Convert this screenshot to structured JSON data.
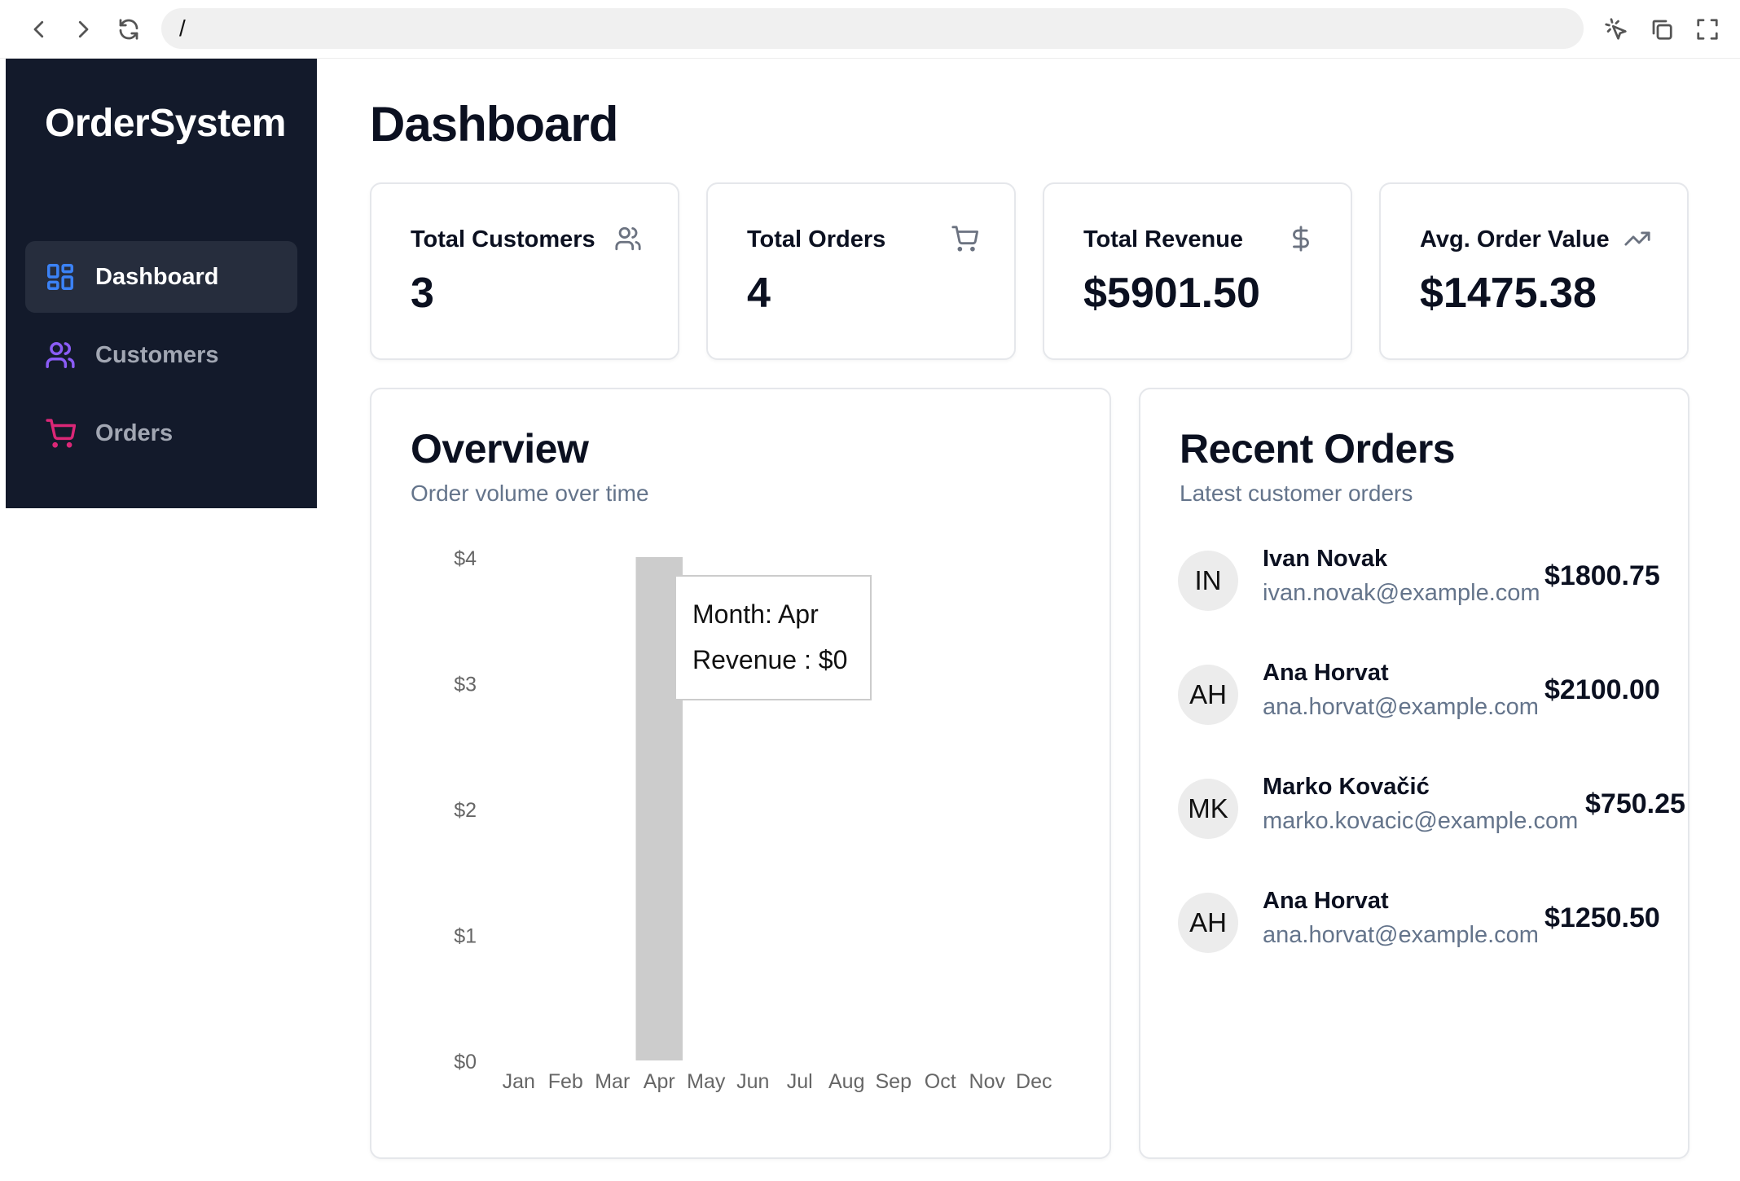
{
  "browser": {
    "url": "/"
  },
  "sidebar": {
    "brand": "OrderSystem",
    "items": [
      {
        "label": "Dashboard",
        "icon": "layout-grid-icon",
        "active": true
      },
      {
        "label": "Customers",
        "icon": "users-icon",
        "active": false
      },
      {
        "label": "Orders",
        "icon": "cart-icon",
        "active": false
      }
    ]
  },
  "page": {
    "title": "Dashboard"
  },
  "stats": [
    {
      "label": "Total Customers",
      "value": "3",
      "icon": "users-icon"
    },
    {
      "label": "Total Orders",
      "value": "4",
      "icon": "cart-icon"
    },
    {
      "label": "Total Revenue",
      "value": "$5901.50",
      "icon": "dollar-icon"
    },
    {
      "label": "Avg. Order Value",
      "value": "$1475.38",
      "icon": "trending-up-icon"
    }
  ],
  "overview": {
    "title": "Overview",
    "subtitle": "Order volume over time",
    "tooltip": {
      "month": "Month: Apr",
      "revenue": "Revenue : $0"
    }
  },
  "chart_data": {
    "type": "bar",
    "categories": [
      "Jan",
      "Feb",
      "Mar",
      "Apr",
      "May",
      "Jun",
      "Jul",
      "Aug",
      "Sep",
      "Oct",
      "Nov",
      "Dec"
    ],
    "values": [
      0,
      0,
      0,
      4,
      0,
      0,
      0,
      0,
      0,
      0,
      0,
      0
    ],
    "y_ticks": [
      "$0",
      "$1",
      "$2",
      "$3",
      "$4"
    ],
    "ylim": [
      0,
      4
    ],
    "highlight_index": 3,
    "grid": false,
    "colors": {
      "highlight": "#cccccc",
      "tick": "#666666"
    }
  },
  "recent_orders": {
    "title": "Recent Orders",
    "subtitle": "Latest customer orders",
    "items": [
      {
        "initials": "IN",
        "name": "Ivan Novak",
        "email": "ivan.novak@example.com",
        "amount": "$1800.75"
      },
      {
        "initials": "AH",
        "name": "Ana Horvat",
        "email": "ana.horvat@example.com",
        "amount": "$2100.00"
      },
      {
        "initials": "MK",
        "name": "Marko Kovačić",
        "email": "marko.kovacic@example.com",
        "amount": "$750.25"
      },
      {
        "initials": "AH",
        "name": "Ana Horvat",
        "email": "ana.horvat@example.com",
        "amount": "$1250.50"
      }
    ]
  },
  "colors": {
    "sidebar_bg": "#131a2b",
    "sidebar_active": "#262d3d",
    "dashboard_icon": "#3b82f6",
    "customers_icon": "#8b5cf6",
    "orders_icon": "#db2777",
    "muted_text": "#64748b"
  }
}
